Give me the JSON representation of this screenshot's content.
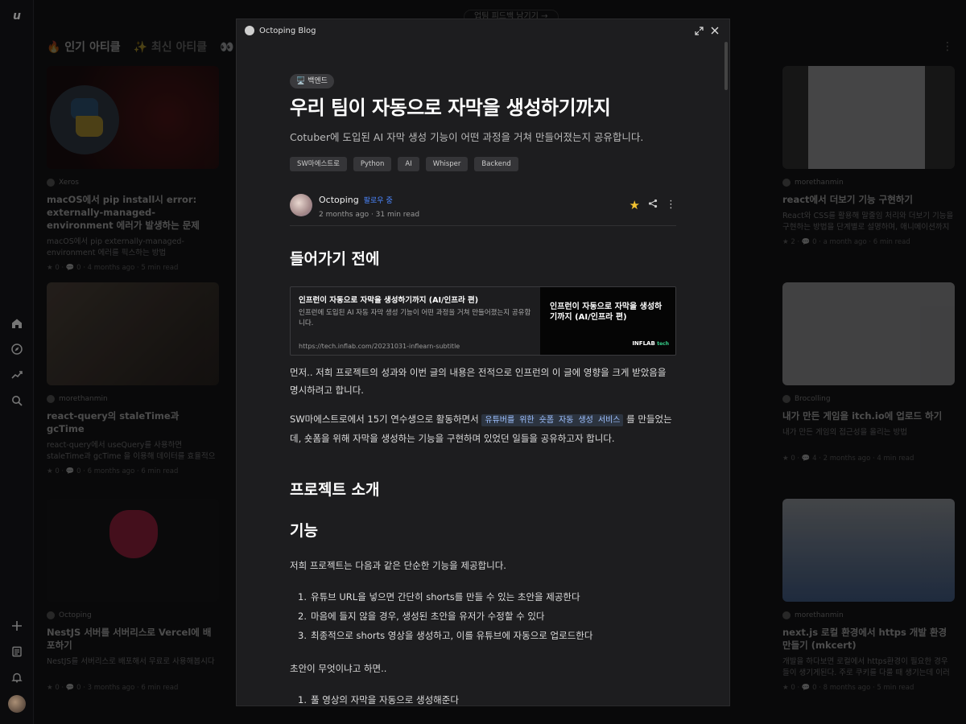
{
  "app": {
    "logo": "u"
  },
  "feed": {
    "top_button": "업팀 피드백 남기기 →",
    "tabs": [
      "🔥 인기 아티클",
      "✨ 최신 아티클",
      "👀 팔로"
    ],
    "cards": [
      {
        "author": "Xeros",
        "title": "macOS에서 pip install시 error: externally-managed-environment 에러가 발생하는 문제",
        "desc": "macOS에서 pip externally-managed-environment 에러를 픽스하는 방법",
        "meta": "★ 0 · 💬 0 · 4 months ago · 5 min read"
      },
      {
        "author": "morethanmin",
        "title": "react에서 더보기 기능 구현하기",
        "desc": "React와 CSS를 활용해 말줄임 처리와 더보기 기능을 구현하는 방법을 단계별로 설명하며, 애니메이션까지 적용해 ...",
        "meta": "★ 2 · 💬 0 · a month ago · 6 min read"
      },
      {
        "author": "morethanmin",
        "title": "react-query의 staleTime과 gcTime",
        "desc": "react-query에서 useQuery를 사용하면 staleTime과 gcTime 을 이용해 데이터를 효율적으로 다룰 수 있다. 들의...",
        "meta": "★ 0 · 💬 0 · 6 months ago · 6 min read"
      },
      {
        "author": "Brocolling",
        "title": "내가 만든 게임을 itch.io에 업로드 하기",
        "desc": "내가 만든 게임의 접근성을 올리는 방법",
        "meta": "★ 0 · 💬 4 · 2 months ago · 4 min read"
      },
      {
        "author": "Octoping",
        "title": "NestJS 서버를 서버리스로 Vercel에 배포하기",
        "desc": "NestJS를 서버리스로 배포해서 무료로 사용해봅시다",
        "meta": "★ 0 · 💬 0 · 3 months ago · 6 min read"
      },
      {
        "author": "morethanmin",
        "title": "next.js 로컬 환경에서 https 개발 환경 만들기 (mkcert)",
        "desc": "개발을 하다보면 로컬에서 https환경이 필요한 경우들이 생기게된다. 주로 쿠키를 다룰 때 생기는데 이러한 개발환경...",
        "meta": "★ 0 · 💬 0 · 8 months ago · 5 min read"
      }
    ]
  },
  "modal": {
    "site_title": "Octoping Blog",
    "category": "🖥️ 백엔드",
    "title": "우리 팀이 자동으로 자막을 생성하기까지",
    "subtitle": "Cotuber에 도입된 AI 자막 생성 기능이 어떤 과정을 거쳐 만들어졌는지 공유합니다.",
    "tags": [
      "SW마에스트로",
      "Python",
      "AI",
      "Whisper",
      "Backend"
    ],
    "author": {
      "name": "Octoping",
      "follow": "팔로우 중",
      "meta": "2 months ago · 31 min read"
    },
    "h_before": "들어가기 전에",
    "link": {
      "title": "인프런이 자동으로 자막을 생성하기까지 (AI/인프라 편)",
      "desc": "인프런에 도입된 AI 자동 자막 생성 기능이 어떤 과정을 거쳐 만들어졌는지 공유합니다.",
      "url": "https://tech.inflab.com/20231031-inflearn-subtitle",
      "image_text": "인프런이 자동으로 자막을 생성하기까지 (AI/인프라 편)",
      "brand": "INFLAB",
      "brand_suffix": "tech"
    },
    "p1": "먼저.. 저희 프로젝트의 성과와 이번 글의 내용은 전적으로 인프런의 이 글에 영향을 크게 받았음을 명시하려고 합니다.",
    "p2_a": "SW마에스트로에서 15기 연수생으로 활동하면서 ",
    "p2_code": "유튜버를 위한 숏폼 자동 생성 서비스",
    "p2_b": " 를 만들었는데, 숏폼을 위해 자막을 생성하는 기능을 구현하며 있었던 일들을 공유하고자 합니다.",
    "h_project": "프로젝트 소개",
    "h_feature": "기능",
    "p3": "저희 프로젝트는 다음과 같은 단순한 기능을 제공합니다.",
    "features": [
      "유튜브 URL을 넣으면 간단히 shorts를 만들 수 있는 초안을 제공한다",
      "마음에 들지 않을 경우, 생성된 초안을 유저가 수정할 수 있다",
      "최종적으로 shorts 영상을 생성하고, 이를 유튜브에 자동으로 업로드한다"
    ],
    "p4": "초안이 무엇이냐고 하면..",
    "drafts": [
      "풀 영상의 자막을 자동으로 생성해준다"
    ]
  }
}
